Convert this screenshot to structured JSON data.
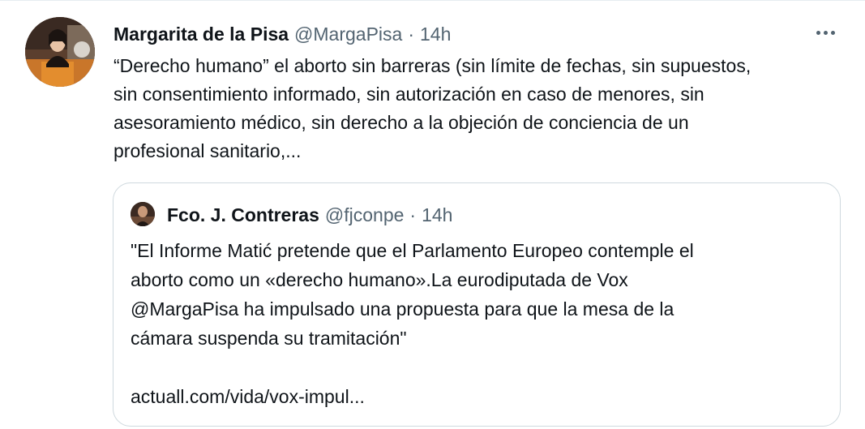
{
  "tweet": {
    "author": {
      "display_name": "Margarita de la Pisa",
      "handle": "@MargaPisa",
      "separator": "·",
      "time": "14h",
      "avatar_icon": "user-avatar-photo"
    },
    "more_icon": "more-horizontal-icon",
    "text_lines": [
      "“Derecho humano” el aborto sin barreras (sin límite de fechas, sin supuestos,",
      "sin consentimiento informado, sin autorización en caso de menores, sin",
      "asesoramiento médico, sin derecho a la objeción de conciencia de un",
      "profesional sanitario,..."
    ]
  },
  "quote": {
    "author": {
      "display_name": "Fco. J. Contreras",
      "handle": "@fjconpe",
      "separator": "·",
      "time": "14h",
      "avatar_icon": "user-avatar-photo"
    },
    "text_lines": [
      "\"El Informe Matić pretende que el Parlamento Europeo contemple el",
      "aborto como un «derecho humano».La eurodiputada de Vox",
      "@MargaPisa ha impulsado una propuesta para que la mesa de la",
      "cámara suspenda su tramitación\""
    ],
    "link": "actuall.com/vida/vox-impul..."
  },
  "colors": {
    "text": "#0f1419",
    "secondary": "#536471",
    "border": "#cfd9de"
  }
}
